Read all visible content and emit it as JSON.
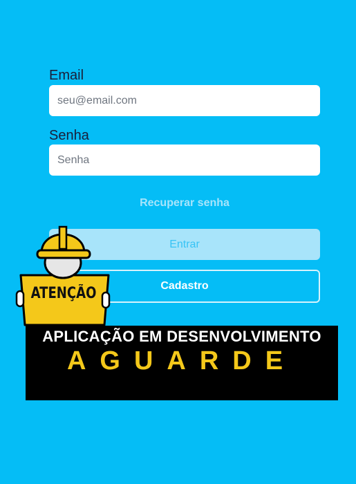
{
  "form": {
    "email_label": "Email",
    "email_placeholder": "seu@email.com",
    "password_label": "Senha",
    "password_placeholder": "Senha",
    "recover_link": "Recuperar senha",
    "enter_button": "Entrar",
    "register_button": "Cadastro"
  },
  "warning": {
    "sign_text": "ATENÇÃO",
    "banner_line1": "APLICAÇÃO EM DESENVOLVIMENTO",
    "banner_line2": "AGUARDE"
  },
  "colors": {
    "background": "#05bdf6",
    "helmet_yellow": "#f4c81a",
    "banner_black": "#000000"
  }
}
